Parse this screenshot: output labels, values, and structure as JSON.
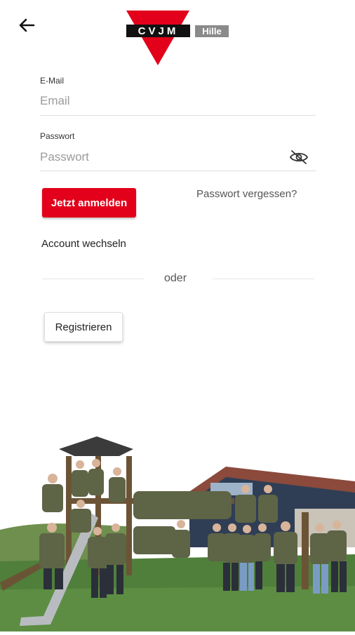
{
  "brand": {
    "logo_text": "CVJM",
    "logo_sub": "Hille",
    "red": "#e2001a"
  },
  "icons": {
    "back": "arrow-left-icon",
    "password_toggle": "eye-off-icon"
  },
  "form": {
    "email_label": "E-Mail",
    "email_placeholder": "Email",
    "password_label": "Passwort",
    "password_placeholder": "Passwort"
  },
  "actions": {
    "login": "Jetzt anmelden",
    "forgot": "Passwort vergessen?",
    "switch_account": "Account wechseln",
    "or": "oder",
    "register": "Registrieren"
  },
  "photo": {
    "description": ""
  }
}
